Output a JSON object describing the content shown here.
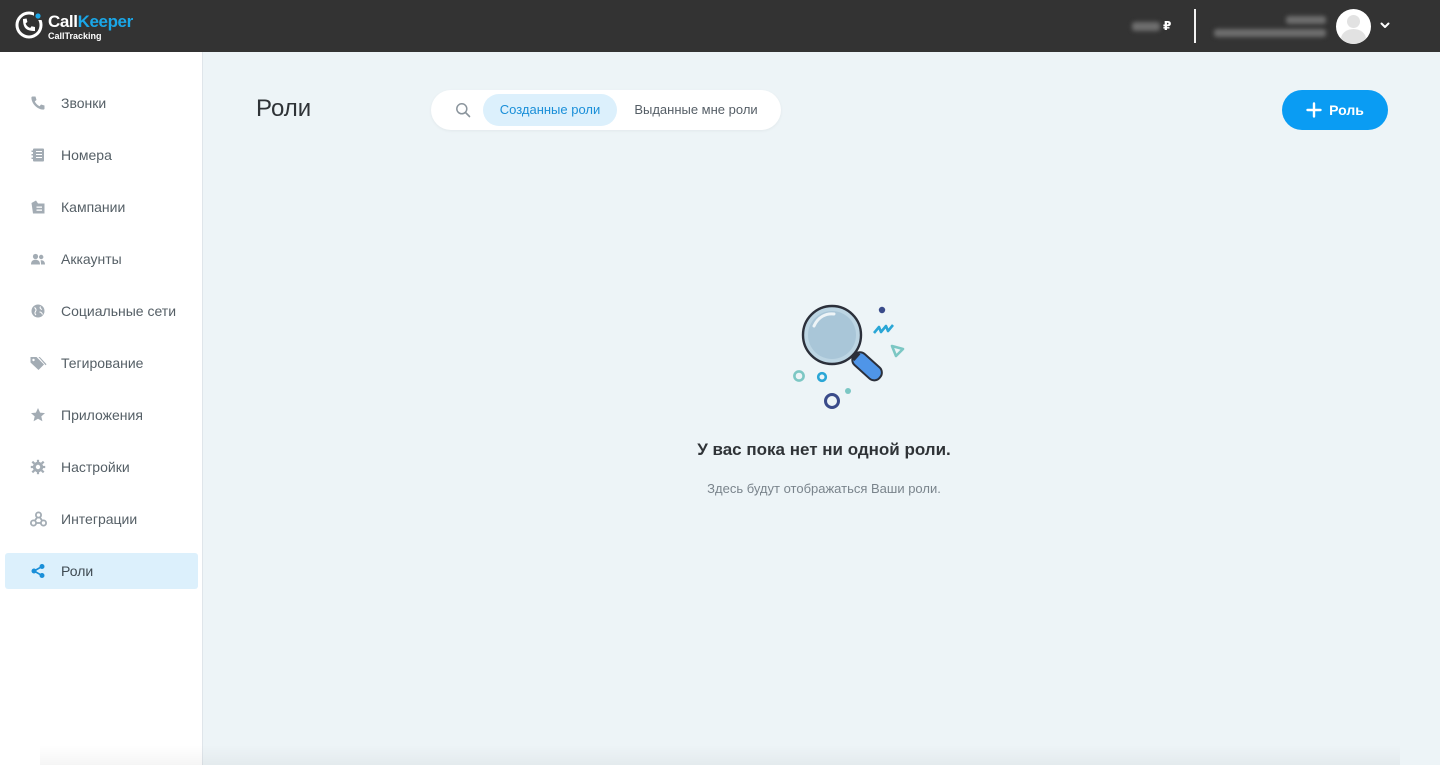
{
  "app": {
    "logo_name_part1": "Call",
    "logo_name_part2": "Keeper",
    "logo_tagline": "CallTracking"
  },
  "header": {
    "currency_symbol": "₽"
  },
  "sidebar": {
    "items": [
      {
        "label": "Звонки",
        "icon": "phone-icon",
        "active": false
      },
      {
        "label": "Номера",
        "icon": "numbers-icon",
        "active": false
      },
      {
        "label": "Кампании",
        "icon": "campaigns-icon",
        "active": false
      },
      {
        "label": "Аккаунты",
        "icon": "users-icon",
        "active": false
      },
      {
        "label": "Социальные сети",
        "icon": "globe-icon",
        "active": false
      },
      {
        "label": "Тегирование",
        "icon": "tag-icon",
        "active": false
      },
      {
        "label": "Приложения",
        "icon": "star-icon",
        "active": false
      },
      {
        "label": "Настройки",
        "icon": "gear-icon",
        "active": false
      },
      {
        "label": "Интеграции",
        "icon": "integrations-icon",
        "active": false
      },
      {
        "label": "Роли",
        "icon": "share-icon",
        "active": true
      }
    ]
  },
  "main": {
    "title": "Роли",
    "tabs": [
      {
        "label": "Созданные роли",
        "active": true
      },
      {
        "label": "Выданные мне роли",
        "active": false
      }
    ],
    "add_button_label": "Роль",
    "empty_state": {
      "title": "У вас пока нет ни одной роли.",
      "subtitle": "Здесь будут отображаться Ваши роли."
    }
  },
  "colors": {
    "topbar": "#333333",
    "accent": "#0a9cf3",
    "logo_accent": "#1aa7e8",
    "active_item_bg": "#dcf0fc",
    "page_bg": "#edf4f7",
    "sidebar_icon": "#9aa3ab",
    "active_icon": "#1a8fd8"
  }
}
